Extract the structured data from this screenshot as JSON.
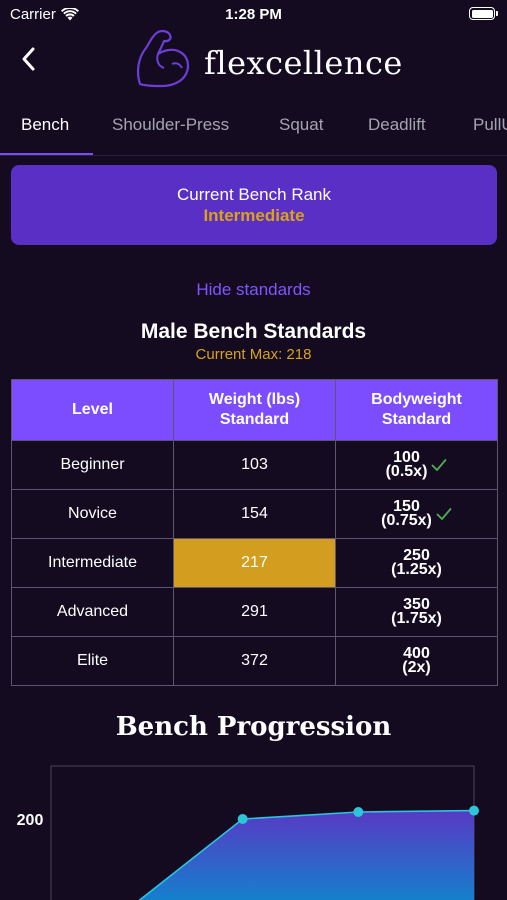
{
  "status_bar": {
    "carrier": "Carrier",
    "time": "1:28 PM"
  },
  "header": {
    "back_icon": "chevron-left-icon",
    "logo_icon": "flexed-arm-icon",
    "title": "flexcellence"
  },
  "tabs": [
    {
      "label": "Bench",
      "active": true
    },
    {
      "label": "Shoulder-Press",
      "active": false
    },
    {
      "label": "Squat",
      "active": false
    },
    {
      "label": "Deadlift",
      "active": false
    },
    {
      "label": "PullU",
      "active": false
    }
  ],
  "rank_card": {
    "title": "Current Bench Rank",
    "value": "Intermediate"
  },
  "standards": {
    "toggle_label": "Hide standards",
    "title": "Male Bench Standards",
    "current_max": "Current Max: 218",
    "headers": {
      "level": "Level",
      "weight_line1": "Weight (lbs)",
      "weight_line2": "Standard",
      "bw_line1": "Bodyweight",
      "bw_line2": "Standard"
    },
    "rows": [
      {
        "level": "Beginner",
        "weight": "103",
        "bw_value": "100",
        "bw_mult": "(0.5x)",
        "achieved": true,
        "highlight": false
      },
      {
        "level": "Novice",
        "weight": "154",
        "bw_value": "150",
        "bw_mult": "(0.75x)",
        "achieved": true,
        "highlight": false
      },
      {
        "level": "Intermediate",
        "weight": "217",
        "bw_value": "250",
        "bw_mult": "(1.25x)",
        "achieved": false,
        "highlight": true
      },
      {
        "level": "Advanced",
        "weight": "291",
        "bw_value": "350",
        "bw_mult": "(1.75x)",
        "achieved": false,
        "highlight": false
      },
      {
        "level": "Elite",
        "weight": "372",
        "bw_value": "400",
        "bw_mult": "(2x)",
        "achieved": false,
        "highlight": false
      }
    ]
  },
  "colors": {
    "background": "#140b21",
    "accent": "#7c4dff",
    "gold": "#d9a21a",
    "check": "#4caf50"
  },
  "progression": {
    "title": "Bench Progression",
    "y_tick_label": "200"
  },
  "chart_data": {
    "type": "area",
    "title": "Bench Progression",
    "xlabel": "",
    "ylabel": "",
    "y_ticks": [
      200
    ],
    "ylim": [
      0,
      240
    ],
    "x": [
      1,
      2,
      3,
      4
    ],
    "series": [
      {
        "values": [
          0,
          200,
          210,
          212
        ]
      }
    ]
  }
}
